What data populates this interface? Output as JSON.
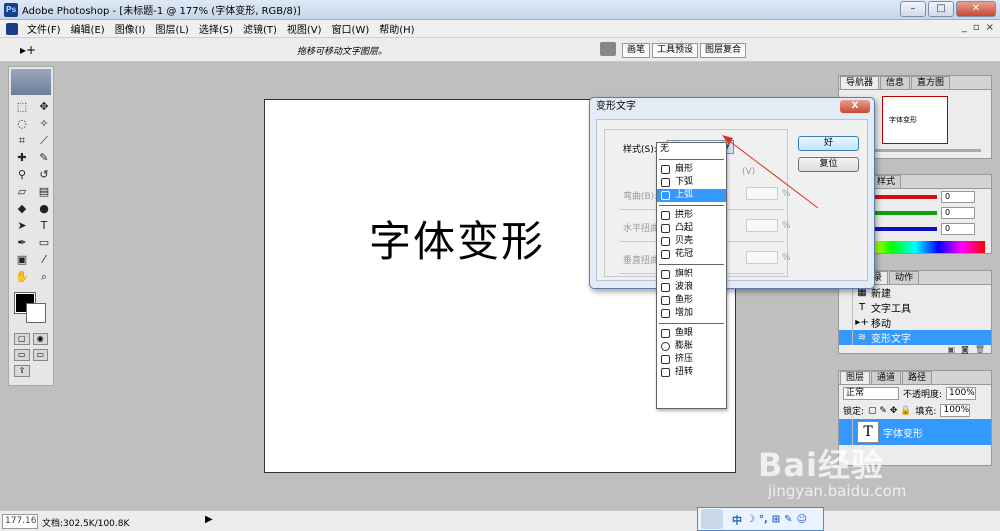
{
  "window": {
    "title": "Adobe Photoshop - [未标题-1 @ 177% (字体变形, RGB/8)]",
    "app_icon_text": "Ps",
    "buttons": [
      "–",
      "□",
      "✕"
    ]
  },
  "menu": {
    "items": [
      "文件(F)",
      "编辑(E)",
      "图像(I)",
      "图层(L)",
      "选择(S)",
      "滤镜(T)",
      "视图(V)",
      "窗口(W)",
      "帮助(H)"
    ],
    "mdi_buttons": [
      "_",
      "▫",
      "×"
    ]
  },
  "options": {
    "tool_glyph": "▸+",
    "hint": "拖移可移动文字图层。",
    "palette_well_tabs": [
      "画笔",
      "工具预设",
      "图层复合"
    ]
  },
  "canvas": {
    "text": "字体变形"
  },
  "status": {
    "zoom": "177.16",
    "doc_info": "文档:302.5K/100.8K",
    "arrow": "▶"
  },
  "ime": {
    "items": [
      "中",
      "☽",
      "°,",
      "⊞",
      "✎",
      "☺"
    ]
  },
  "navigator": {
    "tabs": [
      "导航器",
      "信息",
      "直方图"
    ],
    "thumb_text": "字体变形"
  },
  "color_palette": {
    "tabs": [
      "色板",
      "样式"
    ],
    "values": [
      "0",
      "0",
      "0"
    ],
    "slider_colors": [
      "#d01010",
      "#10a010",
      "#1010c0"
    ]
  },
  "history": {
    "tabs": [
      "历史记录",
      "动作"
    ],
    "items": [
      {
        "icon": "▦",
        "label": "新建"
      },
      {
        "icon": "T",
        "label": "文字工具"
      },
      {
        "icon": "▸+",
        "label": "移动"
      },
      {
        "icon": "≋",
        "label": "变形文字"
      }
    ]
  },
  "layers": {
    "tabs": [
      "图层",
      "通道",
      "路径"
    ],
    "blend_mode": "正常",
    "opacity_label": "不透明度:",
    "opacity": "100%",
    "lock_label": "锁定:",
    "fill_label": "填充:",
    "fill": "100%",
    "layer_name": "字体变形",
    "layer_thumb": "T"
  },
  "dialog": {
    "title": "变形文字",
    "close": "X",
    "style_label": "样式(S):",
    "style_value": "无",
    "orientation_tail": "(V)",
    "bend_label": "弯曲(B):",
    "hdist_label": "水平扭曲(O",
    "vdist_label": "垂直扭曲(E",
    "pct": "%",
    "ok": "好",
    "reset": "复位"
  },
  "dropdown": {
    "groups": [
      [
        "无"
      ],
      [
        "扇形",
        "下弧",
        "上弧"
      ],
      [
        "拱形",
        "凸起",
        "贝壳",
        "花冠"
      ],
      [
        "旗帜",
        "波浪",
        "鱼形",
        "增加"
      ],
      [
        "鱼眼",
        "膨胀",
        "挤压",
        "扭转"
      ]
    ],
    "selected": "上弧"
  },
  "annotation_color": "#e0301e",
  "watermark": {
    "logo": "Bai经验",
    "url": "jingyan.baidu.com"
  }
}
